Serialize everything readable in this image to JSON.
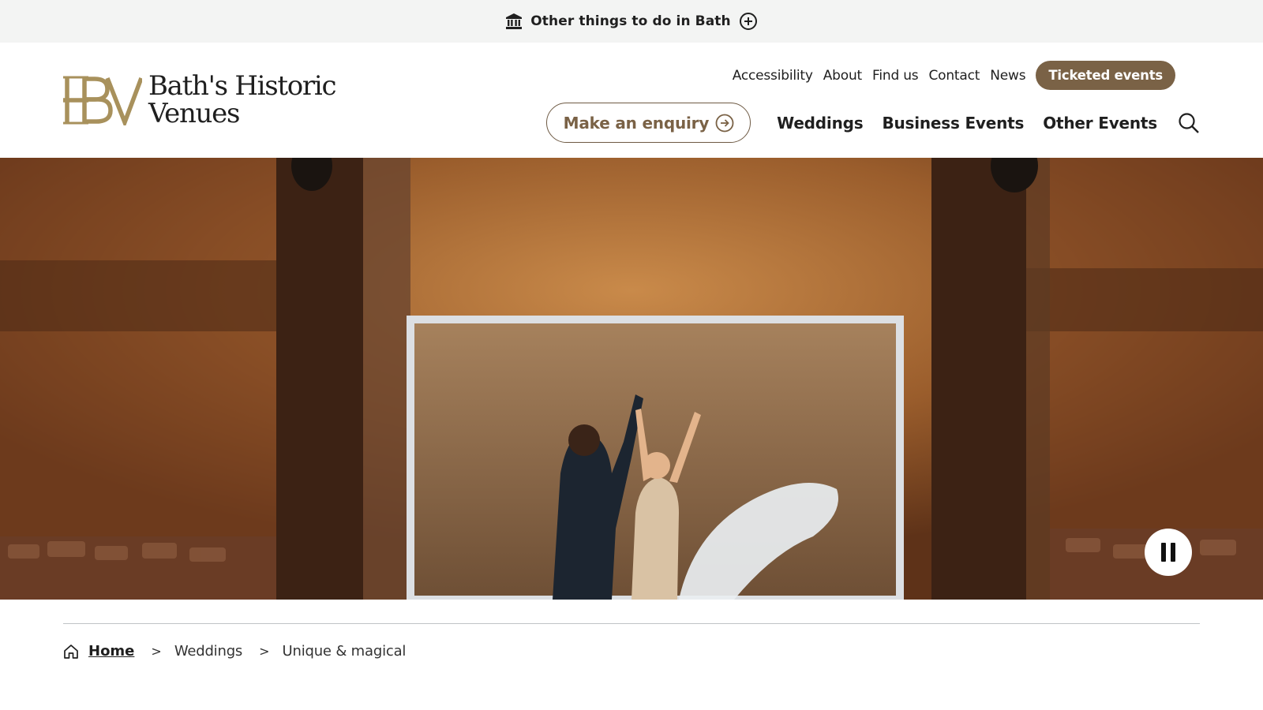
{
  "topbar": {
    "label": "Other things to do in Bath",
    "leading_icon": "museum-icon",
    "trailing_icon": "plus-circle-icon"
  },
  "logo": {
    "monogram": "HBV",
    "line1": "Bath's Historic",
    "line2": "Venues",
    "brand_color": "#a8915c"
  },
  "utility_nav": {
    "items": [
      {
        "label": "Accessibility"
      },
      {
        "label": "About"
      },
      {
        "label": "Find us"
      },
      {
        "label": "Contact"
      },
      {
        "label": "News"
      }
    ],
    "cta": "Ticketed events"
  },
  "main_nav": {
    "enquiry": "Make an enquiry",
    "items": [
      {
        "label": "Weddings"
      },
      {
        "label": "Business Events"
      },
      {
        "label": "Other Events"
      }
    ],
    "search_icon": "search-icon"
  },
  "hero": {
    "control": "pause",
    "control_icon": "pause-icon"
  },
  "breadcrumb": {
    "home": "Home",
    "separator": ">",
    "items": [
      {
        "label": "Weddings"
      },
      {
        "label": "Unique & magical"
      }
    ]
  },
  "colors": {
    "accent_brown": "#7a6246",
    "topbar_bg": "#f3f4f3",
    "divider": "#bfc3c6"
  }
}
